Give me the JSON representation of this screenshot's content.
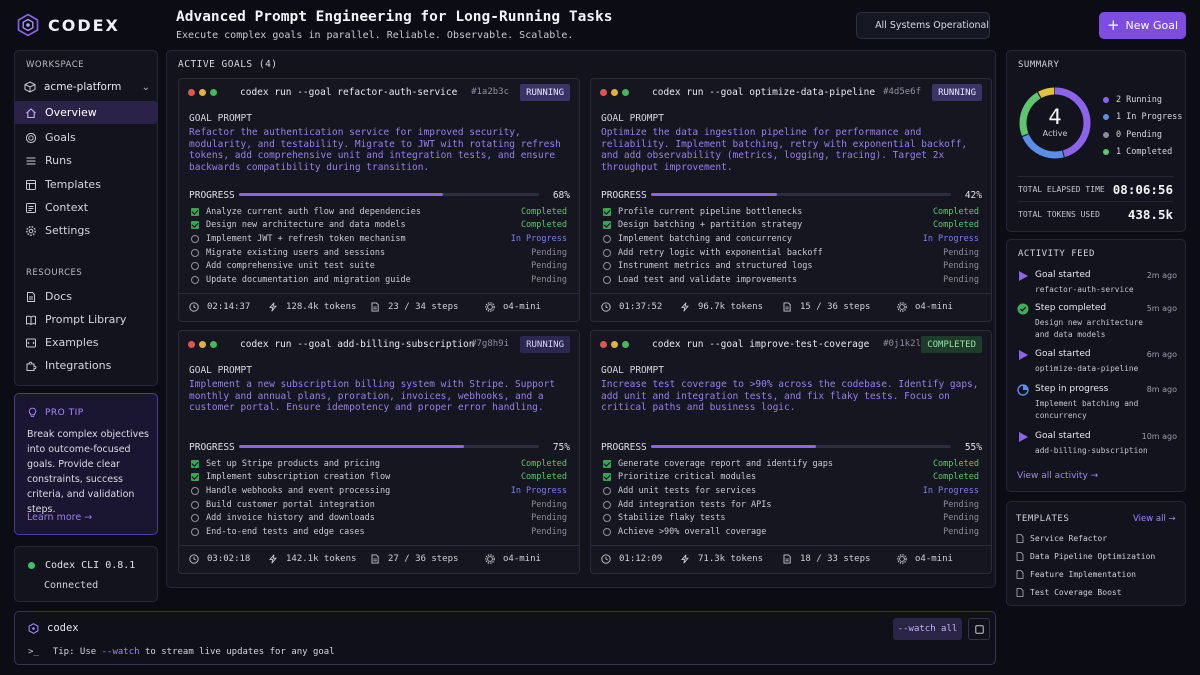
{
  "brand": {
    "name": "CODEX"
  },
  "header": {
    "title": "Advanced Prompt Engineering for Long-Running Tasks",
    "subtitle": "Execute complex goals in parallel. Reliable. Observable. Scalable.",
    "status": "All Systems Operational",
    "new_goal_label": "New Goal"
  },
  "sidebar": {
    "workspace_label": "WORKSPACE",
    "workspace_value": "acme-platform",
    "nav": [
      {
        "label": "Overview",
        "icon": "home-icon",
        "active": true
      },
      {
        "label": "Goals",
        "icon": "target-icon"
      },
      {
        "label": "Runs",
        "icon": "list-icon"
      },
      {
        "label": "Templates",
        "icon": "template-icon"
      },
      {
        "label": "Context",
        "icon": "folder-icon"
      },
      {
        "label": "Settings",
        "icon": "gear-icon"
      }
    ],
    "resources_label": "RESOURCES",
    "resources": [
      {
        "label": "Docs",
        "icon": "doc-icon"
      },
      {
        "label": "Prompt Library",
        "icon": "book-icon"
      },
      {
        "label": "Examples",
        "icon": "code-icon"
      },
      {
        "label": "Integrations",
        "icon": "puzzle-icon"
      }
    ],
    "tip": {
      "label": "PRO TIP",
      "body": "Break complex objectives into outcome-focused goals. Provide clear constraints, success criteria, and validation steps.",
      "link": "Learn more →"
    },
    "cli": {
      "version": "Codex CLI 0.8.1",
      "status": "Connected"
    }
  },
  "goals": {
    "heading": "ACTIVE GOALS (4)",
    "cards": [
      {
        "cmd": "codex run --goal refactor-auth-service",
        "hash": "#1a2b3c",
        "badge": "RUNNING",
        "prompt_label": "GOAL PROMPT",
        "prompt": "Refactor the authentication service for improved security, modularity, and testability. Migrate to JWT with rotating refresh tokens, add comprehensive unit and integration tests, and ensure backwards compatibility during transition.",
        "progress_label": "PROGRESS",
        "progress": 0.68,
        "progress_text": "68%",
        "tasks": [
          {
            "text": "Analyze current auth flow and dependencies",
            "status": "Completed"
          },
          {
            "text": "Design new architecture and data models",
            "status": "Completed"
          },
          {
            "text": "Implement JWT + refresh token mechanism",
            "status": "In Progress"
          },
          {
            "text": "Migrate existing users and sessions",
            "status": "Pending"
          },
          {
            "text": "Add comprehensive unit test suite",
            "status": "Pending"
          },
          {
            "text": "Update documentation and migration guide",
            "status": "Pending"
          }
        ],
        "elapsed": "02:14:37",
        "tokens": "128.4k tokens",
        "steps": "23 / 34 steps",
        "model": "o4-mini"
      },
      {
        "cmd": "codex run --goal optimize-data-pipeline",
        "hash": "#4d5e6f",
        "badge": "RUNNING",
        "prompt_label": "GOAL PROMPT",
        "prompt": "Optimize the data ingestion pipeline for performance and reliability. Implement batching, retry with exponential backoff, and add observability (metrics, logging, tracing). Target 2x throughput improvement.",
        "progress_label": "PROGRESS",
        "progress": 0.42,
        "progress_text": "42%",
        "tasks": [
          {
            "text": "Profile current pipeline bottlenecks",
            "status": "Completed"
          },
          {
            "text": "Design batching + partition strategy",
            "status": "Completed"
          },
          {
            "text": "Implement batching and concurrency",
            "status": "In Progress"
          },
          {
            "text": "Add retry logic with exponential backoff",
            "status": "Pending"
          },
          {
            "text": "Instrument metrics and structured logs",
            "status": "Pending"
          },
          {
            "text": "Load test and validate improvements",
            "status": "Pending"
          }
        ],
        "elapsed": "01:37:52",
        "tokens": "96.7k tokens",
        "steps": "15 / 36 steps",
        "model": "o4-mini"
      },
      {
        "cmd": "codex run --goal add-billing-subscription",
        "hash": "#7g8h9i",
        "badge": "RUNNING",
        "prompt_label": "GOAL PROMPT",
        "prompt": "Implement a new subscription billing system with Stripe. Support monthly and annual plans, proration, invoices, webhooks, and a customer portal. Ensure idempotency and proper error handling.",
        "progress_label": "PROGRESS",
        "progress": 0.75,
        "progress_text": "75%",
        "tasks": [
          {
            "text": "Set up Stripe products and pricing",
            "status": "Completed"
          },
          {
            "text": "Implement subscription creation flow",
            "status": "Completed"
          },
          {
            "text": "Handle webhooks and event processing",
            "status": "In Progress"
          },
          {
            "text": "Build customer portal integration",
            "status": "Pending"
          },
          {
            "text": "Add invoice history and downloads",
            "status": "Pending"
          },
          {
            "text": "End-to-end tests and edge cases",
            "status": "Pending"
          }
        ],
        "elapsed": "03:02:18",
        "tokens": "142.1k tokens",
        "steps": "27 / 36 steps",
        "model": "o4-mini"
      },
      {
        "cmd": "codex run --goal improve-test-coverage",
        "hash": "#0j1k2l",
        "badge": "COMPLETED",
        "prompt_label": "GOAL PROMPT",
        "prompt": "Increase test coverage to >90% across the codebase. Identify gaps, add unit and integration tests, and fix flaky tests. Focus on critical paths and business logic.",
        "progress_label": "PROGRESS",
        "progress": 0.55,
        "progress_text": "55%",
        "tasks": [
          {
            "text": "Generate coverage report and identify gaps",
            "status": "Completed"
          },
          {
            "text": "Prioritize critical modules",
            "status": "Completed"
          },
          {
            "text": "Add unit tests for services",
            "status": "In Progress"
          },
          {
            "text": "Add integration tests for APIs",
            "status": "Pending"
          },
          {
            "text": "Stabilize flaky tests",
            "status": "Pending"
          },
          {
            "text": "Achieve >90% overall coverage",
            "status": "Pending"
          }
        ],
        "elapsed": "01:12:09",
        "tokens": "71.3k tokens",
        "steps": "18 / 33 steps",
        "model": "o4-mini"
      }
    ]
  },
  "summary": {
    "title": "SUMMARY",
    "active_count": "4",
    "active_label": "Active",
    "legend": [
      {
        "count": 2,
        "label": "Running",
        "color": "#8c64ec"
      },
      {
        "count": 1,
        "label": "In Progress",
        "color": "#5b8ee8"
      },
      {
        "count": 0,
        "label": "Pending",
        "color": "#8a8c9c"
      },
      {
        "count": 1,
        "label": "Completed",
        "color": "#5fc66f"
      }
    ],
    "donut_segments": [
      {
        "value": 2,
        "color": "#8c64ec"
      },
      {
        "value": 1,
        "color": "#5b8ee8"
      },
      {
        "value": 1,
        "color": "#5fc66f"
      },
      {
        "value": 0.35,
        "color": "#e2c23a"
      }
    ],
    "elapsed_label": "TOTAL ELAPSED TIME",
    "elapsed_value": "08:06:56",
    "tokens_label": "TOTAL TOKENS USED",
    "tokens_value": "438.5k"
  },
  "activity": {
    "title": "ACTIVITY FEED",
    "items": [
      {
        "icon": "play-icon",
        "title": "Goal started",
        "time": "2m ago",
        "detail": "refactor-auth-service"
      },
      {
        "icon": "check-circle-icon",
        "title": "Step completed",
        "time": "5m ago",
        "detail": "Design new architecture and data models"
      },
      {
        "icon": "play-icon",
        "title": "Goal started",
        "time": "6m ago",
        "detail": "optimize-data-pipeline"
      },
      {
        "icon": "progress-icon",
        "title": "Step in progress",
        "time": "8m ago",
        "detail": "Implement batching and concurrency"
      },
      {
        "icon": "play-icon",
        "title": "Goal started",
        "time": "10m ago",
        "detail": "add-billing-subscription"
      }
    ],
    "view_all": "View all activity →"
  },
  "templates": {
    "title": "TEMPLATES",
    "view_all": "View all →",
    "items": [
      "Service Refactor",
      "Data Pipeline Optimization",
      "Feature Implementation",
      "Test Coverage Boost"
    ]
  },
  "terminal": {
    "name": "codex",
    "prompt": ">_",
    "tip_prefix": "Tip: Use ",
    "tip_flag": "--watch",
    "tip_suffix": " to stream live updates for any goal",
    "watch_button": "--watch all"
  }
}
